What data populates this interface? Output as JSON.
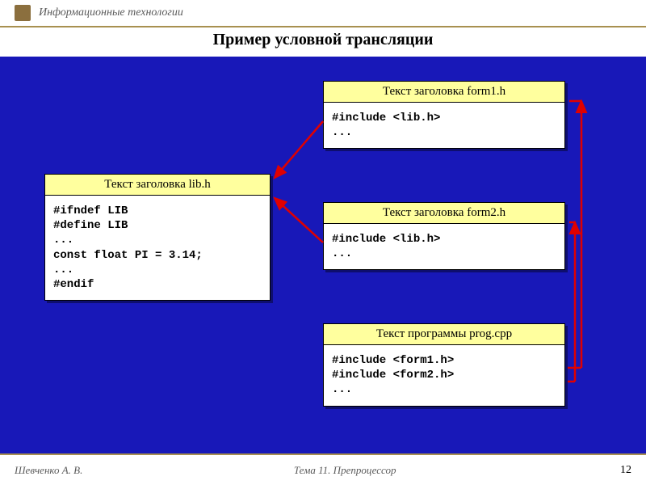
{
  "header": {
    "course_title": "Информационные технологии"
  },
  "slide": {
    "title": "Пример условной трансляции"
  },
  "boxes": {
    "lib": {
      "title": "Текст заголовка lib.h",
      "code": "#ifndef LIB\n#define LIB\n...\nconst float PI = 3.14;\n...\n#endif"
    },
    "form1": {
      "title": "Текст заголовка form1.h",
      "code": "#include <lib.h>\n..."
    },
    "form2": {
      "title": "Текст заголовка form2.h",
      "code": "#include <lib.h>\n..."
    },
    "prog": {
      "title": "Текст программы prog.cpp",
      "code": "#include <form1.h>\n#include <form2.h>\n..."
    }
  },
  "footer": {
    "author": "Шевченко А. В.",
    "topic": "Тема 11. Препроцессор",
    "page": "12"
  }
}
